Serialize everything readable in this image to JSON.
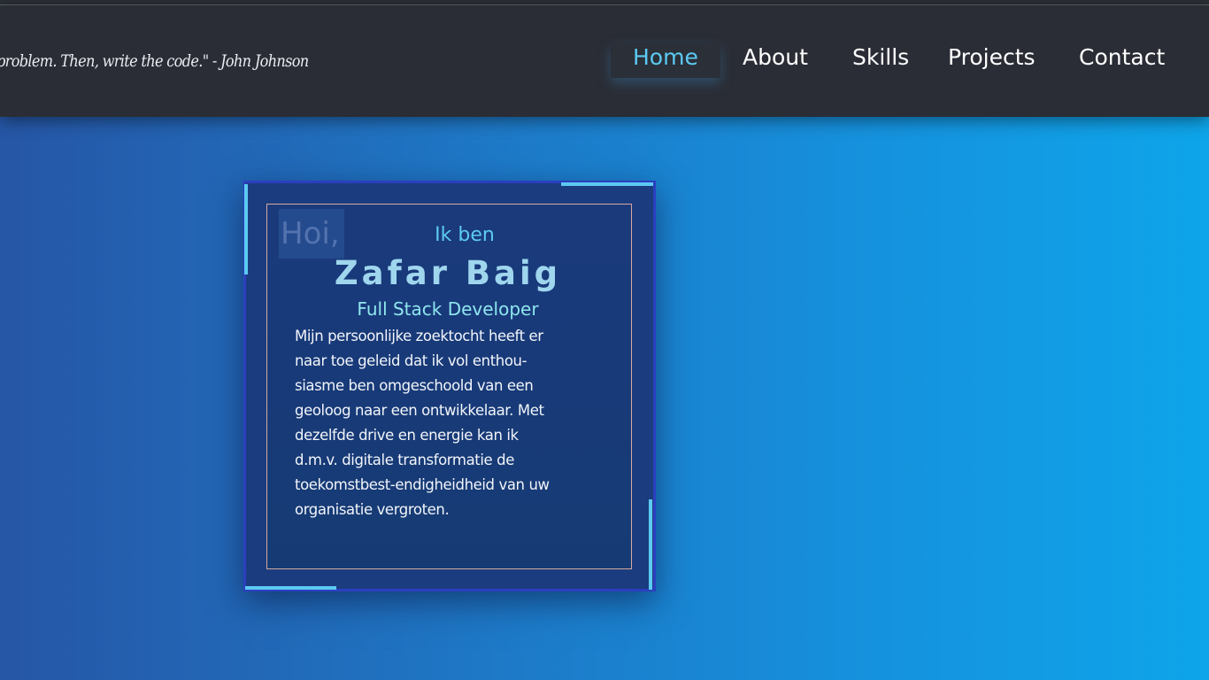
{
  "header": {
    "quote": "problem. Then, write the code.\" - John Johnson",
    "nav": [
      {
        "label": "Home",
        "active": true
      },
      {
        "label": "About",
        "active": false
      },
      {
        "label": "Skills",
        "active": false
      },
      {
        "label": "Projects",
        "active": false
      },
      {
        "label": "Contact",
        "active": false
      }
    ]
  },
  "hero": {
    "greeting": "Hoi,",
    "intro": "Ik ben",
    "name": "Zafar Baig",
    "role": "Full Stack Developer",
    "bio_lines": [
      "Mijn persoonlijke zoektocht heeft er",
      "naar toe geleid dat ik vol enthou-",
      "siasme ben omgeschoold van een",
      "geoloog naar een ontwikkelaar. Met",
      "dezelfde drive en energie kan ik",
      "d.m.v. digitale transformatie de",
      "toekomstbest-endigheidheid van uw",
      "organisatie vergroten."
    ]
  },
  "colors": {
    "accent": "#5ccaf2",
    "header_bg": "#2a2d35",
    "card_border": "#2b3fbf",
    "background_left": "#2656a6",
    "background_right": "#0ea5ea"
  }
}
